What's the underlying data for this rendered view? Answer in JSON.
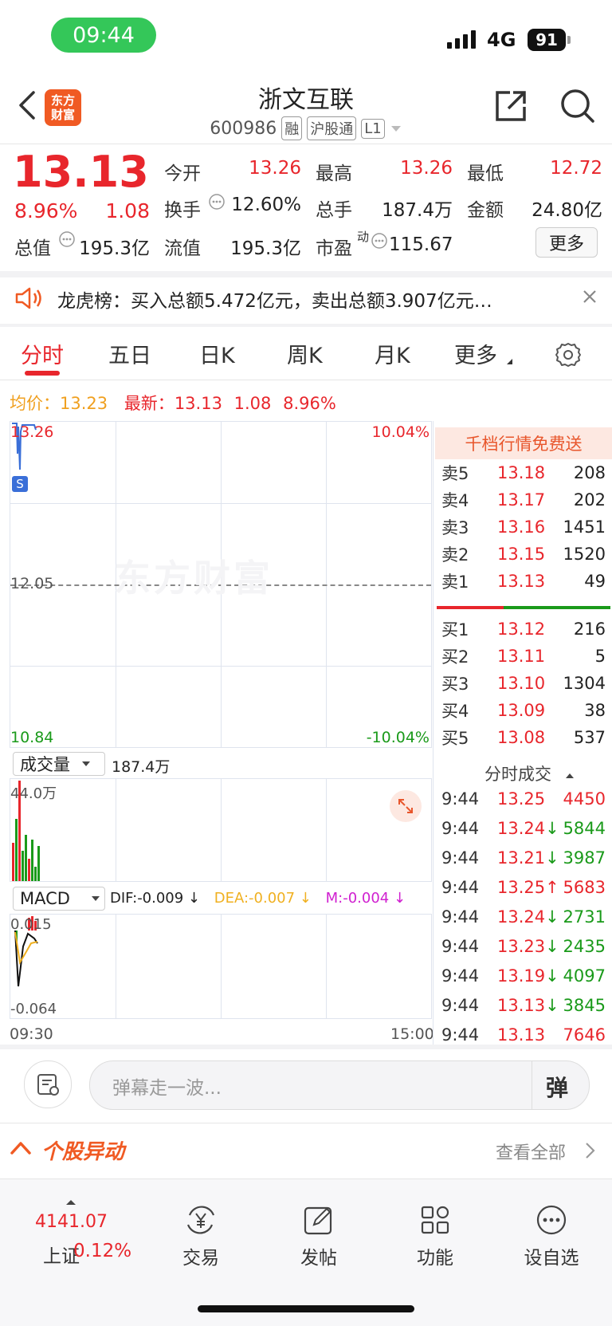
{
  "status_bar": {
    "time": "09:44",
    "network": "4G",
    "battery": "91"
  },
  "header": {
    "title": "浙文互联",
    "code": "600986",
    "tags": [
      "融",
      "沪股通",
      "L1"
    ],
    "logo_text": "东方财富"
  },
  "quote": {
    "price": "13.13",
    "change_pct": "8.96%",
    "change": "1.08",
    "rows": [
      [
        {
          "label": "今开",
          "value": "13.26",
          "color": "red"
        },
        {
          "label": "最高",
          "value": "13.26",
          "color": "red"
        },
        {
          "label": "最低",
          "value": "12.72",
          "color": "red"
        }
      ],
      [
        {
          "label": "换手",
          "value": "12.60%",
          "color": "dark"
        },
        {
          "label": "总手",
          "value": "187.4万",
          "color": "dark"
        },
        {
          "label": "金额",
          "value": "24.80亿",
          "color": "dark"
        }
      ],
      [
        {
          "label": "总值",
          "value": "195.3亿",
          "color": "dark"
        },
        {
          "label": "流值",
          "value": "195.3亿",
          "color": "dark"
        },
        {
          "label": "市盈",
          "value": "115.67",
          "color": "dark"
        }
      ]
    ],
    "pe_superscript": "动",
    "more_label": "更多"
  },
  "notice": {
    "text": "龙虎榜：买入总额5.472亿元，卖出总额3.907亿元…"
  },
  "tabs": [
    "分时",
    "五日",
    "日K",
    "周K",
    "月K",
    "更多"
  ],
  "avg_line": {
    "avg_label": "均价：",
    "avg_value": "13.23",
    "latest_label": "最新：",
    "latest_value": "13.13",
    "change": "1.08",
    "change_pct": "8.96%"
  },
  "chart": {
    "top_left": "13.26",
    "top_right": "10.04%",
    "mid_left": "12.05",
    "bottom_left": "10.84",
    "bottom_right": "-10.04%",
    "watermark": "东方财富",
    "volume_selector": "成交量",
    "volume_total": "187.4万",
    "volume_max": "44.0万",
    "macd_selector": "MACD",
    "dif": "DIF:-0.009 ↓",
    "dea": "DEA:-0.007 ↓",
    "m": "M:-0.004 ↓",
    "macd_top": "0.015",
    "macd_bottom": "-0.064",
    "time_start": "09:30",
    "time_end": "15:00",
    "marker": "S"
  },
  "orderbook": {
    "header": "千档行情免费送",
    "asks": [
      {
        "label": "卖5",
        "price": "13.18",
        "vol": "208"
      },
      {
        "label": "卖4",
        "price": "13.17",
        "vol": "202"
      },
      {
        "label": "卖3",
        "price": "13.16",
        "vol": "1451"
      },
      {
        "label": "卖2",
        "price": "13.15",
        "vol": "1520"
      },
      {
        "label": "卖1",
        "price": "13.13",
        "vol": "49"
      }
    ],
    "bids": [
      {
        "label": "买1",
        "price": "13.12",
        "vol": "216"
      },
      {
        "label": "买2",
        "price": "13.11",
        "vol": "5"
      },
      {
        "label": "买3",
        "price": "13.10",
        "vol": "1304"
      },
      {
        "label": "买4",
        "price": "13.09",
        "vol": "38"
      },
      {
        "label": "买5",
        "price": "13.08",
        "vol": "537"
      }
    ]
  },
  "trades": {
    "header": "分时成交",
    "rows": [
      {
        "time": "9:44",
        "price": "13.25",
        "arrow": "",
        "vol": "4450",
        "pcolor": "red",
        "vcolor": "red"
      },
      {
        "time": "9:44",
        "price": "13.24",
        "arrow": "↓",
        "vol": "5844",
        "pcolor": "red",
        "vcolor": "green"
      },
      {
        "time": "9:44",
        "price": "13.21",
        "arrow": "↓",
        "vol": "3987",
        "pcolor": "red",
        "vcolor": "green"
      },
      {
        "time": "9:44",
        "price": "13.25",
        "arrow": "↑",
        "vol": "5683",
        "pcolor": "red",
        "vcolor": "red"
      },
      {
        "time": "9:44",
        "price": "13.24",
        "arrow": "↓",
        "vol": "2731",
        "pcolor": "red",
        "vcolor": "green"
      },
      {
        "time": "9:44",
        "price": "13.23",
        "arrow": "↓",
        "vol": "2435",
        "pcolor": "red",
        "vcolor": "green"
      },
      {
        "time": "9:44",
        "price": "13.19",
        "arrow": "↓",
        "vol": "4097",
        "pcolor": "red",
        "vcolor": "green"
      },
      {
        "time": "9:44",
        "price": "13.13",
        "arrow": "↓",
        "vol": "3845",
        "pcolor": "red",
        "vcolor": "green"
      },
      {
        "time": "9:44",
        "price": "13.13",
        "arrow": "",
        "vol": "7646",
        "pcolor": "red",
        "vcolor": "red"
      }
    ]
  },
  "danmu": {
    "placeholder": "弹幕走一波...",
    "button": "弹"
  },
  "movement": {
    "title": "个股异动",
    "link": "查看全部"
  },
  "tabbar": {
    "index_value": "4141.07",
    "index_name": "上证",
    "index_change": "0.12%",
    "items": [
      "交易",
      "发帖",
      "功能",
      "设自选"
    ]
  },
  "colors": {
    "up": "#e8262c",
    "down": "#1a9a1a",
    "accent": "#f05a23",
    "avg": "#f0a020"
  }
}
